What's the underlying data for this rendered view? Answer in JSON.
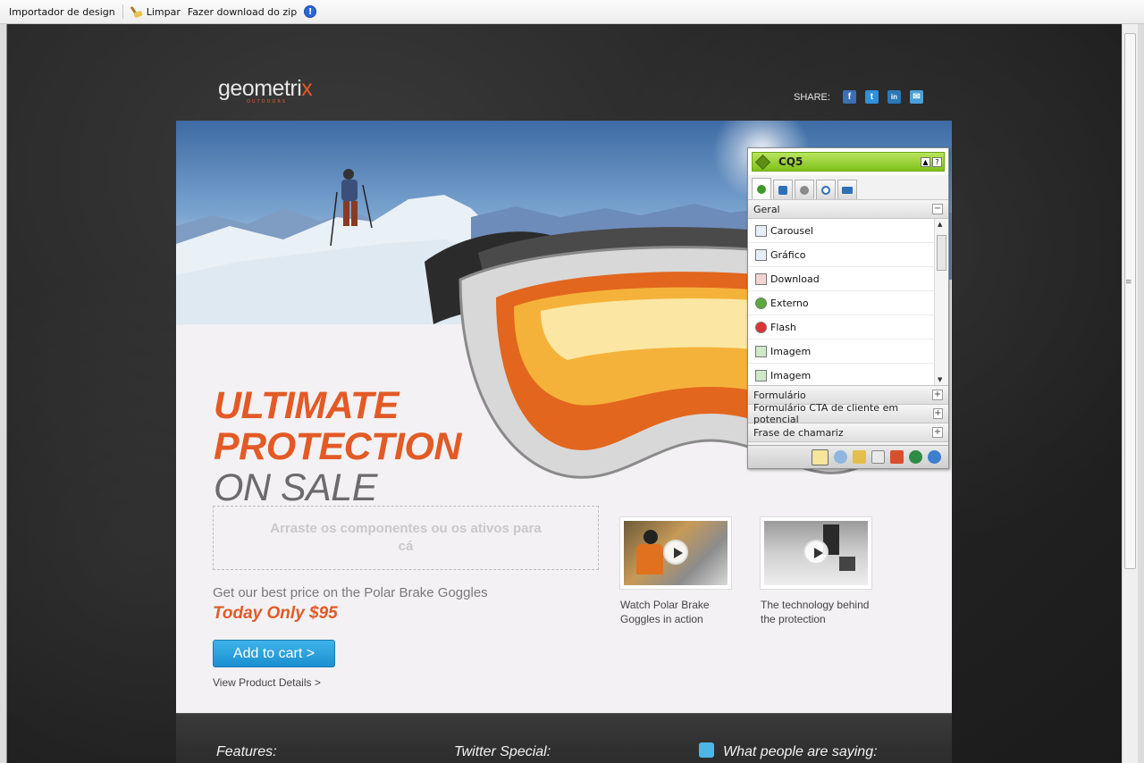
{
  "toolbar": {
    "importer_label": "Importador de design",
    "clear_label": "Limpar",
    "download_label": "Fazer download do zip",
    "info_glyph": "!"
  },
  "brand": {
    "logo_text": "geometri",
    "logo_x": "x",
    "logo_sub": "OUTDOORS",
    "accent": "#e35a26"
  },
  "share": {
    "label": "SHARE:",
    "icons": [
      "facebook-icon",
      "twitter-icon",
      "linkedin-icon",
      "email-icon"
    ],
    "glyphs": [
      "f",
      "t",
      "in",
      "✉"
    ]
  },
  "hero": {
    "line1": "ULTIMATE",
    "line2": "PROTECTION",
    "line3": "ON SALE"
  },
  "dropzone": {
    "text": "Arraste os componentes ou os ativos para cá"
  },
  "offer": {
    "price_line": "Get our best price on the Polar Brake Goggles",
    "price": "Today Only $95",
    "cart_button": "Add to cart  >",
    "details_link": "View Product Details >"
  },
  "videos": [
    {
      "caption": "Watch Polar Brake Goggles in action"
    },
    {
      "caption": "The technology behind the protection"
    }
  ],
  "footer": {
    "features": "Features:",
    "twitter_special": "Twitter Special:",
    "people_saying": "What people are saying:"
  },
  "sidekick": {
    "title": "CQ5",
    "section_geral": "Geral",
    "items": [
      "Carousel",
      "Gráfico",
      "Download",
      "Externo",
      "Flash",
      "Imagem",
      "Imagem"
    ],
    "section_formulario": "Formulário",
    "section_cta": "Formulário CTA de cliente em potencial",
    "section_frase": "Frase de chamariz",
    "minus": "−",
    "plus": "+"
  }
}
